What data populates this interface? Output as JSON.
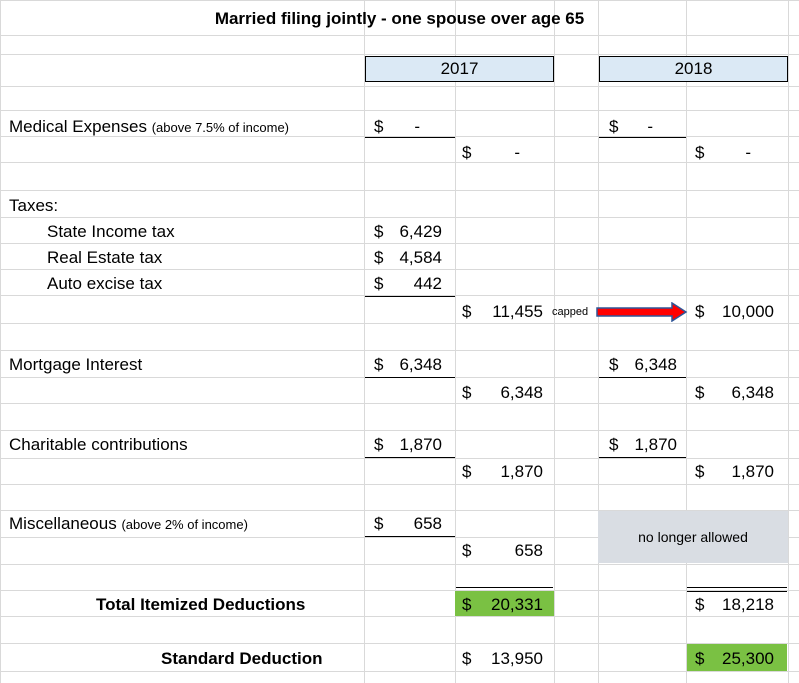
{
  "title": "Married filing jointly - one spouse over age 65",
  "colors": {
    "header_fill": "#dbe9f5",
    "highlight_green": "#7ac143",
    "gray_box": "#d9dde3",
    "arrow_red": "#ff0000",
    "arrow_blue": "#2f5597"
  },
  "headers": {
    "y2017": "2017",
    "y2018": "2018"
  },
  "medical": {
    "label": "Medical Expenses",
    "note": "(above 7.5% of income)",
    "y2017_detail": {
      "sym": "$",
      "amt": "-"
    },
    "y2017_total": {
      "sym": "$",
      "amt": "-"
    },
    "y2018_detail": {
      "sym": "$",
      "amt": "-"
    },
    "y2018_total": {
      "sym": "$",
      "amt": "-"
    }
  },
  "taxes": {
    "label": "Taxes:",
    "items": [
      {
        "label": "State Income tax",
        "sym": "$",
        "amt": "6,429"
      },
      {
        "label": "Real Estate tax",
        "sym": "$",
        "amt": "4,584"
      },
      {
        "label": "Auto excise tax",
        "sym": "$",
        "amt": "442"
      }
    ],
    "y2017_total": {
      "sym": "$",
      "amt": "11,455"
    },
    "capped_label": "capped",
    "y2018_total": {
      "sym": "$",
      "amt": "10,000"
    }
  },
  "mortgage": {
    "label": "Mortgage Interest",
    "y2017_detail": {
      "sym": "$",
      "amt": "6,348"
    },
    "y2017_total": {
      "sym": "$",
      "amt": "6,348"
    },
    "y2018_detail": {
      "sym": "$",
      "amt": "6,348"
    },
    "y2018_total": {
      "sym": "$",
      "amt": "6,348"
    }
  },
  "charitable": {
    "label": "Charitable contributions",
    "y2017_detail": {
      "sym": "$",
      "amt": "1,870"
    },
    "y2017_total": {
      "sym": "$",
      "amt": "1,870"
    },
    "y2018_detail": {
      "sym": "$",
      "amt": "1,870"
    },
    "y2018_total": {
      "sym": "$",
      "amt": "1,870"
    }
  },
  "misc": {
    "label": "Miscellaneous",
    "note": "(above 2% of income)",
    "y2017_detail": {
      "sym": "$",
      "amt": "658"
    },
    "y2017_total": {
      "sym": "$",
      "amt": "658"
    },
    "y2018_note": "no longer allowed"
  },
  "totals": {
    "itemized_label": "Total Itemized Deductions",
    "itemized_2017": {
      "sym": "$",
      "amt": "20,331"
    },
    "itemized_2018": {
      "sym": "$",
      "amt": "18,218"
    },
    "standard_label": "Standard Deduction",
    "standard_2017": {
      "sym": "$",
      "amt": "13,950"
    },
    "standard_2018": {
      "sym": "$",
      "amt": "25,300"
    }
  }
}
